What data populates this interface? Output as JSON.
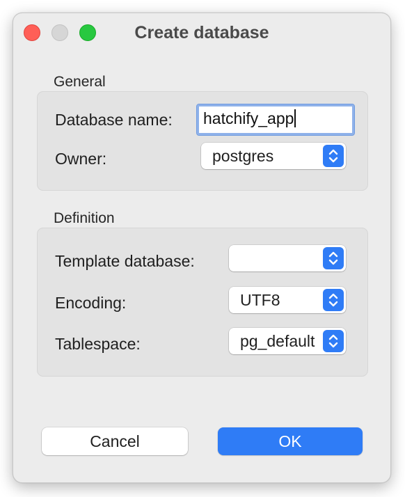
{
  "window": {
    "title": "Create database"
  },
  "general": {
    "label": "General",
    "database_name_label": "Database name:",
    "database_name_value": "hatchify_app",
    "owner_label": "Owner:",
    "owner_value": "postgres"
  },
  "definition": {
    "label": "Definition",
    "template_label": "Template database:",
    "template_value": "",
    "encoding_label": "Encoding:",
    "encoding_value": "UTF8",
    "tablespace_label": "Tablespace:",
    "tablespace_value": "pg_default"
  },
  "buttons": {
    "cancel_label": "Cancel",
    "ok_label": "OK"
  },
  "colors": {
    "accent": "#2f7cf6",
    "close": "#ff5f57",
    "zoom": "#28c840"
  }
}
